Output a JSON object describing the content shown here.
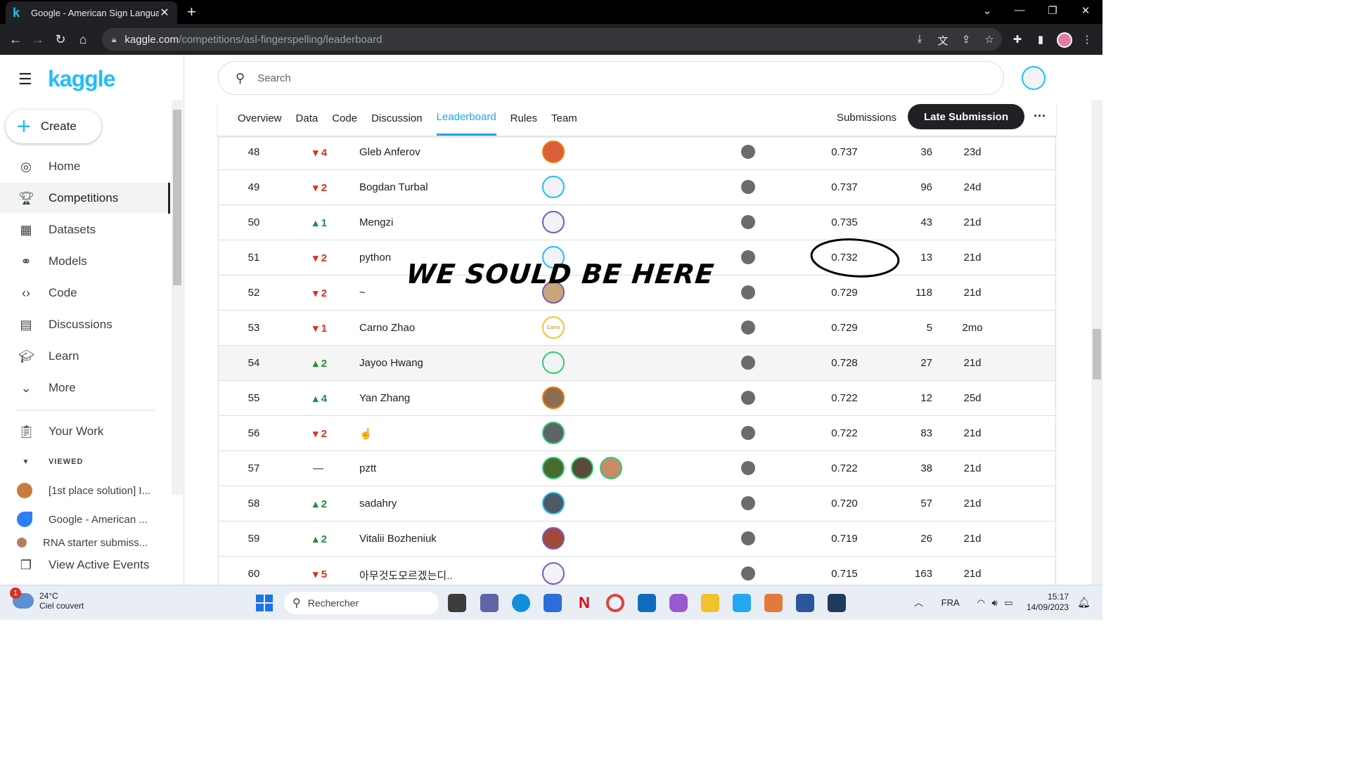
{
  "browser": {
    "tab_title": "Google - American Sign Languag",
    "url_host": "kaggle.com",
    "url_path": "/competitions/asl-fingerspelling/leaderboard"
  },
  "sidebar": {
    "logo": "kaggle",
    "create_label": "Create",
    "items": [
      {
        "label": "Home",
        "icon": "compass-icon"
      },
      {
        "label": "Competitions",
        "icon": "trophy-icon"
      },
      {
        "label": "Datasets",
        "icon": "table-icon"
      },
      {
        "label": "Models",
        "icon": "models-icon"
      },
      {
        "label": "Code",
        "icon": "code-icon"
      },
      {
        "label": "Discussions",
        "icon": "discussion-icon"
      },
      {
        "label": "Learn",
        "icon": "learn-icon"
      },
      {
        "label": "More",
        "icon": "chevron-down-icon"
      }
    ],
    "your_work": "Your Work",
    "viewed_header": "VIEWED",
    "viewed": [
      "[1st place solution] I...",
      "Google - American ...",
      "RNA starter submiss..."
    ],
    "active_events": "View Active Events"
  },
  "search": {
    "placeholder": "Search"
  },
  "competition_tabs": [
    "Overview",
    "Data",
    "Code",
    "Discussion",
    "Leaderboard",
    "Rules",
    "Team"
  ],
  "active_tab": "Leaderboard",
  "submissions_label": "Submissions",
  "late_submission_label": "Late Submission",
  "leaderboard": [
    {
      "rank": "48",
      "delta": "4",
      "dir": "down",
      "team": "Gleb Anferov",
      "score": "0.737",
      "entries": "36",
      "last": "23d"
    },
    {
      "rank": "49",
      "delta": "2",
      "dir": "down",
      "team": "Bogdan Turbal",
      "score": "0.737",
      "entries": "96",
      "last": "24d"
    },
    {
      "rank": "50",
      "delta": "1",
      "dir": "up",
      "team": "Mengzi",
      "score": "0.735",
      "entries": "43",
      "last": "21d"
    },
    {
      "rank": "51",
      "delta": "2",
      "dir": "down",
      "team": "python",
      "score": "0.732",
      "entries": "13",
      "last": "21d"
    },
    {
      "rank": "52",
      "delta": "2",
      "dir": "down",
      "team": "~",
      "score": "0.729",
      "entries": "118",
      "last": "21d"
    },
    {
      "rank": "53",
      "delta": "1",
      "dir": "down",
      "team": "Carno Zhao",
      "score": "0.729",
      "entries": "5",
      "last": "2mo"
    },
    {
      "rank": "54",
      "delta": "2",
      "dir": "up",
      "team": "Jayoo Hwang",
      "score": "0.728",
      "entries": "27",
      "last": "21d"
    },
    {
      "rank": "55",
      "delta": "4",
      "dir": "up",
      "team": "Yan Zhang",
      "score": "0.722",
      "entries": "12",
      "last": "25d"
    },
    {
      "rank": "56",
      "delta": "2",
      "dir": "down",
      "team": "☝",
      "score": "0.722",
      "entries": "83",
      "last": "21d"
    },
    {
      "rank": "57",
      "delta": "—",
      "dir": "same",
      "team": "pztt",
      "score": "0.722",
      "entries": "38",
      "last": "21d"
    },
    {
      "rank": "58",
      "delta": "2",
      "dir": "up",
      "team": "sadahry",
      "score": "0.720",
      "entries": "57",
      "last": "21d"
    },
    {
      "rank": "59",
      "delta": "2",
      "dir": "up",
      "team": "Vitalii Bozheniuk",
      "score": "0.719",
      "entries": "26",
      "last": "21d"
    },
    {
      "rank": "60",
      "delta": "5",
      "dir": "down",
      "team": "아무것도모르겠는디..",
      "score": "0.715",
      "entries": "163",
      "last": "21d"
    }
  ],
  "carno_avatar_text": "Carno",
  "annotation": "WE SOULD BE HERE",
  "taskbar": {
    "weather_temp": "24°C",
    "weather_desc": "Ciel couvert",
    "weather_badge": "1",
    "search_label": "Rechercher",
    "language": "FRA",
    "time": "15:17",
    "date": "14/09/2023"
  },
  "colors": {
    "kaggle_blue": "#20beff",
    "up": "#1e8e3e",
    "down": "#d93025"
  }
}
